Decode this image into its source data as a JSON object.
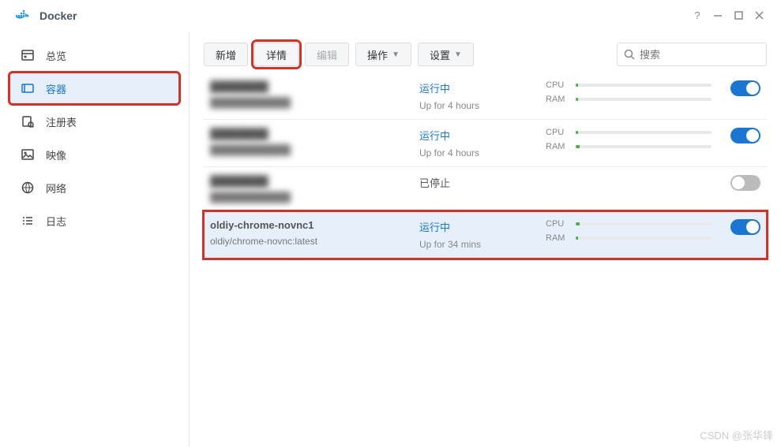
{
  "window": {
    "title": "Docker"
  },
  "sidebar": {
    "items": [
      {
        "label": "总览"
      },
      {
        "label": "容器"
      },
      {
        "label": "注册表"
      },
      {
        "label": "映像"
      },
      {
        "label": "网络"
      },
      {
        "label": "日志"
      }
    ]
  },
  "toolbar": {
    "create": "新增",
    "detail": "详情",
    "edit": "编辑",
    "action": "操作",
    "settings": "设置"
  },
  "search": {
    "placeholder": "搜索"
  },
  "metrics_labels": {
    "cpu": "CPU",
    "ram": "RAM"
  },
  "containers": [
    {
      "name_hidden": true,
      "status": "运行中",
      "uptime": "Up for 4 hours",
      "running": true,
      "cpu": 2,
      "ram": 2
    },
    {
      "name_hidden": true,
      "status": "运行中",
      "uptime": "Up for 4 hours",
      "running": true,
      "cpu": 2,
      "ram": 3
    },
    {
      "name_hidden": true,
      "status": "已停止",
      "uptime": "",
      "running": false
    },
    {
      "name": "oldiy-chrome-novnc1",
      "image": "oldiy/chrome-novnc:latest",
      "status": "运行中",
      "uptime": "Up for 34 mins",
      "running": true,
      "cpu": 3,
      "ram": 2,
      "selected": true
    }
  ],
  "watermark": "CSDN @张华锋"
}
